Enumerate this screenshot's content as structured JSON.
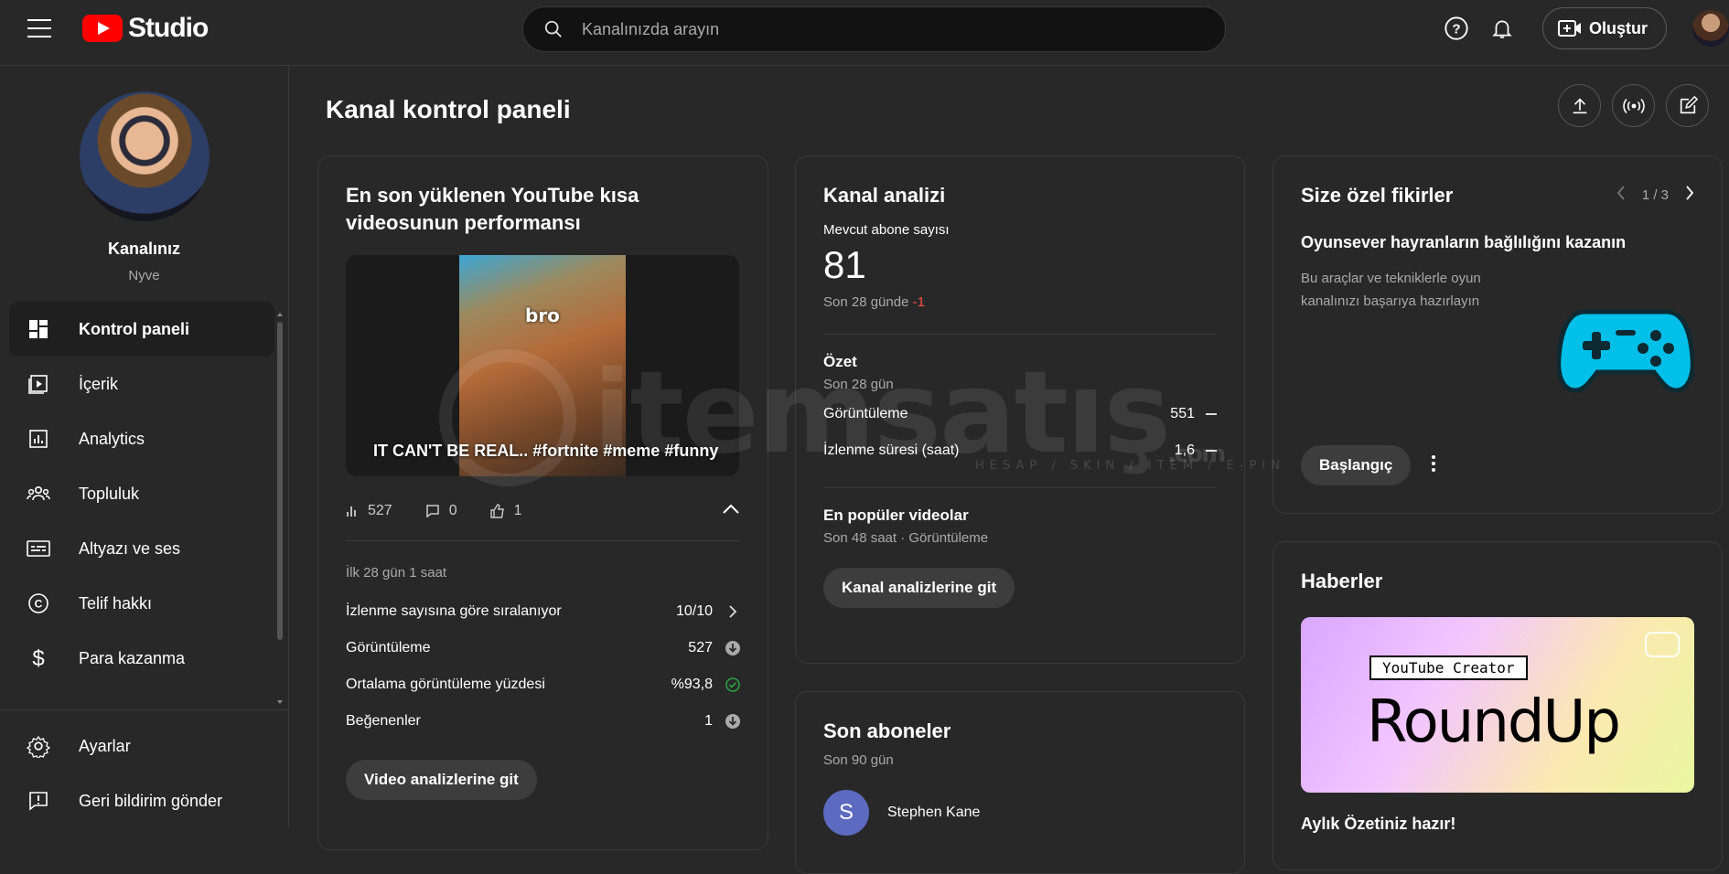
{
  "topbar": {
    "brand": "Studio",
    "search_placeholder": "Kanalınızda arayın",
    "create_label": "Oluştur"
  },
  "sidebar": {
    "channel_title": "Kanalınız",
    "channel_handle": "Nyve",
    "items": [
      {
        "label": "Kontrol paneli",
        "icon": "dashboard-icon",
        "active": true
      },
      {
        "label": "İçerik",
        "icon": "content-icon"
      },
      {
        "label": "Analytics",
        "icon": "analytics-icon"
      },
      {
        "label": "Topluluk",
        "icon": "community-icon"
      },
      {
        "label": "Altyazı ve ses",
        "icon": "subtitles-icon"
      },
      {
        "label": "Telif hakkı",
        "icon": "copyright-icon"
      },
      {
        "label": "Para kazanma",
        "icon": "monetization-icon"
      }
    ],
    "bottom_items": [
      {
        "label": "Ayarlar",
        "icon": "gear-icon"
      },
      {
        "label": "Geri bildirim gönder",
        "icon": "feedback-icon"
      }
    ]
  },
  "main": {
    "page_title": "Kanal kontrol paneli",
    "latest_short": {
      "title": "En son yüklenen YouTube kısa videosunun performansı",
      "thumb_overlay": "bro",
      "video_title": "IT CAN'T BE REAL.. #fortnite #meme #funny",
      "views": "527",
      "comments": "0",
      "likes": "1",
      "period": "İlk 28 gün 1 saat",
      "rows": [
        {
          "label": "İzlenme sayısına göre sıralanıyor",
          "value": "10/10",
          "icon": "chevron-right-icon"
        },
        {
          "label": "Görüntüleme",
          "value": "527",
          "icon": "down-circle-icon"
        },
        {
          "label": "Ortalama görüntüleme yüzdesi",
          "value": "%93,8",
          "icon": "check-circle-icon"
        },
        {
          "label": "Beğenenler",
          "value": "1",
          "icon": "down-circle-icon"
        }
      ],
      "button": "Video analizlerine git"
    },
    "analytics": {
      "title": "Kanal analizi",
      "subs_label": "Mevcut abone sayısı",
      "subs_value": "81",
      "subs_change_prefix": "Son 28 günde ",
      "subs_change": "-1",
      "summary_title": "Özet",
      "summary_period": "Son 28 gün",
      "summary_rows": [
        {
          "label": "Görüntüleme",
          "value": "551"
        },
        {
          "label": "İzlenme süresi (saat)",
          "value": "1,6"
        }
      ],
      "popular_title": "En popüler videolar",
      "popular_sub": "Son 48 saat · Görüntüleme",
      "button": "Kanal analizlerine git"
    },
    "subscribers": {
      "title": "Son aboneler",
      "period": "Son 90 gün",
      "items": [
        {
          "initial": "S",
          "name": "Stephen Kane"
        }
      ]
    },
    "ideas": {
      "title": "Size özel fikirler",
      "pager": "1 / 3",
      "idea_title": "Oyunsever hayranların bağlılığını kazanın",
      "idea_desc": "Bu araçlar ve tekniklerle oyun kanalınızı başarıya hazırlayın",
      "button": "Başlangıç"
    },
    "news": {
      "title": "Haberler",
      "img_label": "YouTube Creator",
      "img_big": "RoundUp",
      "footer": "Aylık Özetiniz hazır!"
    }
  },
  "watermark": {
    "text": "itemsatış",
    "sub": "HESAP / SKIN / ITEM / E-PIN",
    "com": ".com"
  }
}
